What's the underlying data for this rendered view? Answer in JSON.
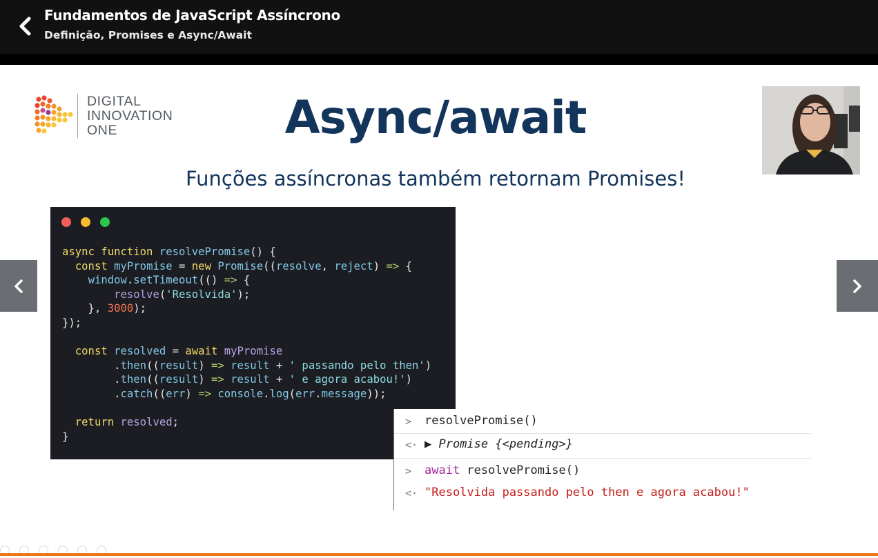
{
  "header": {
    "title": "Fundamentos de JavaScript Assíncrono",
    "subtitle": "Definição, Promises e Async/Await"
  },
  "logo": {
    "line1": "DIGITAL",
    "line2": "INNOVATION",
    "line3": "ONE"
  },
  "slide": {
    "title": "Async/await",
    "subtitle": "Funções assíncronas também retornam Promises!"
  },
  "code": {
    "dots_colors": [
      "#f25f58",
      "#f6bd2f",
      "#2cc84b"
    ],
    "colors": {
      "keyword": "#f0d868",
      "ident": "#7fc6e2",
      "fn": "#86c9e6",
      "string": "#8fdde6",
      "number": "#f5764f",
      "purple": "#b8a2e2",
      "arrow": "#b6d26a",
      "plain": "#e7e7e7"
    }
  },
  "console": {
    "rows": [
      {
        "prompt": ">",
        "text": "resolvePromise()"
      },
      {
        "prompt": "<·",
        "text": "▶ Promise {<pending>}"
      },
      {
        "prompt": ">",
        "keyword": "await",
        "text": " resolvePromise()"
      },
      {
        "prompt": "<·",
        "text": "\"Resolvida passando pelo then e agora acabou!\""
      }
    ]
  },
  "nav": {
    "prev_icon": "chevron-left-icon",
    "next_icon": "chevron-right-icon"
  },
  "accent": "#e97818"
}
